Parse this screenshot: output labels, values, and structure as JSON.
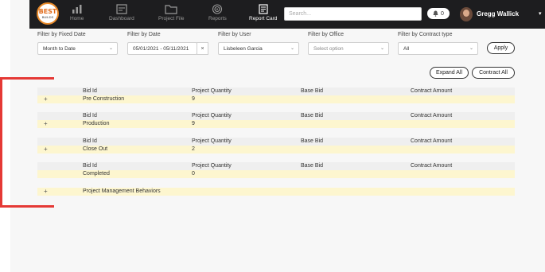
{
  "nav": {
    "logo": {
      "text": "BEST",
      "sub": "BUILDS"
    },
    "items": [
      {
        "label": "Home",
        "icon": "bar-chart-icon",
        "active": false
      },
      {
        "label": "Dashboard",
        "icon": "dashboard-icon",
        "active": false
      },
      {
        "label": "Project File",
        "icon": "folder-icon",
        "active": false
      },
      {
        "label": "Reports",
        "icon": "target-icon",
        "active": false
      },
      {
        "label": "Report Card",
        "icon": "report-card-icon",
        "active": true
      }
    ],
    "search_placeholder": "Search...",
    "notification_count": "0",
    "user_name": "Gregg Wallick"
  },
  "filters": {
    "fixed_date": {
      "label": "Filter by Fixed Date",
      "value": "Month to Date"
    },
    "date": {
      "label": "Filter by Date",
      "value": "05/01/2021 - 05/11/2021",
      "clear": "×"
    },
    "user": {
      "label": "Filter by User",
      "value": "Lisbeleen Garcia"
    },
    "office": {
      "label": "Filter by Office",
      "value": "Select option"
    },
    "contract_type": {
      "label": "Filter by Contract type",
      "value": "All"
    },
    "apply_label": "Apply"
  },
  "actions": {
    "expand_all": "Expand All",
    "contract_all": "Contract All"
  },
  "columns": {
    "bid_id": "Bid Id",
    "project_quantity": "Project Quantity",
    "base_bid": "Base Bid",
    "contract_amount": "Contract Amount"
  },
  "groups": [
    {
      "name": "Pre Construction",
      "quantity": "9",
      "expandable": true
    },
    {
      "name": "Production",
      "quantity": "9",
      "expandable": true
    },
    {
      "name": "Close Out",
      "quantity": "2",
      "expandable": true
    },
    {
      "name": "Completed",
      "quantity": "0",
      "expandable": false
    }
  ],
  "behaviors": {
    "name": "Project Management Behaviors"
  },
  "colors": {
    "nav_bg": "#1d1d1f",
    "row_head_bg": "#efefef",
    "row_body_bg": "#fdf6cf",
    "highlight": "#e53935",
    "logo_orange": "#e06b1a"
  }
}
